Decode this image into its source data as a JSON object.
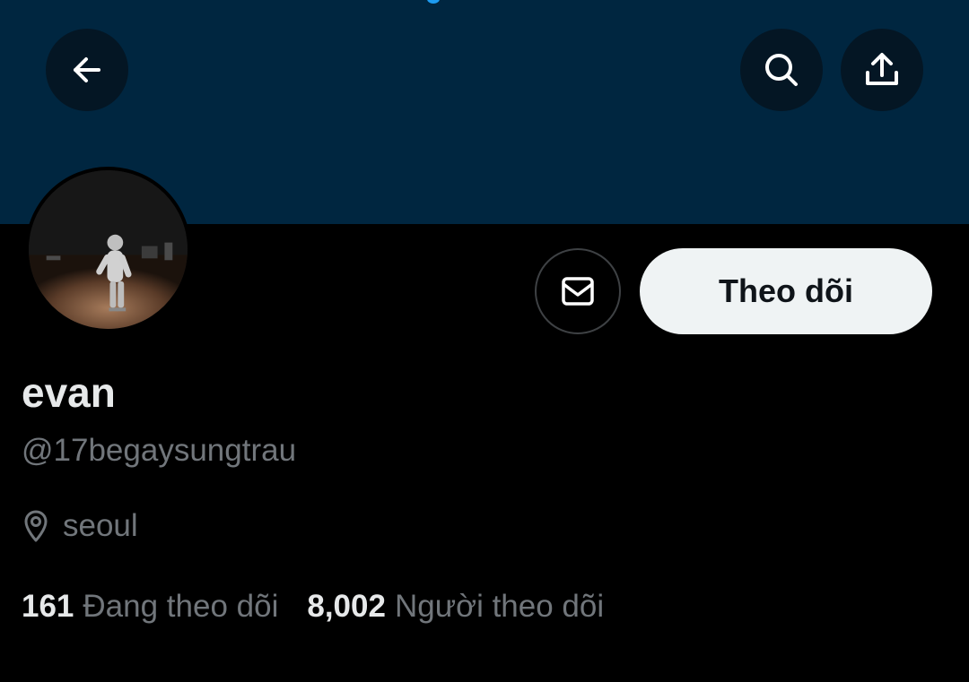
{
  "header": {
    "back_icon": "arrow-left-icon",
    "search_icon": "search-icon",
    "share_icon": "share-upload-icon"
  },
  "colors": {
    "banner": "#002640",
    "background": "#000000",
    "primary_text": "#e7e9ea",
    "secondary_text": "#71767b",
    "follow_button_bg": "#eff3f4",
    "follow_button_text": "#0f1419"
  },
  "profile": {
    "display_name": "evan",
    "handle": "@17begaysungtrau",
    "location": "seoul",
    "location_icon": "location-pin-icon"
  },
  "actions": {
    "message_icon": "envelope-icon",
    "follow_label": "Theo dõi"
  },
  "stats": {
    "following_count": "161",
    "following_label": "Đang theo dõi",
    "followers_count": "8,002",
    "followers_label": "Người theo dõi"
  }
}
